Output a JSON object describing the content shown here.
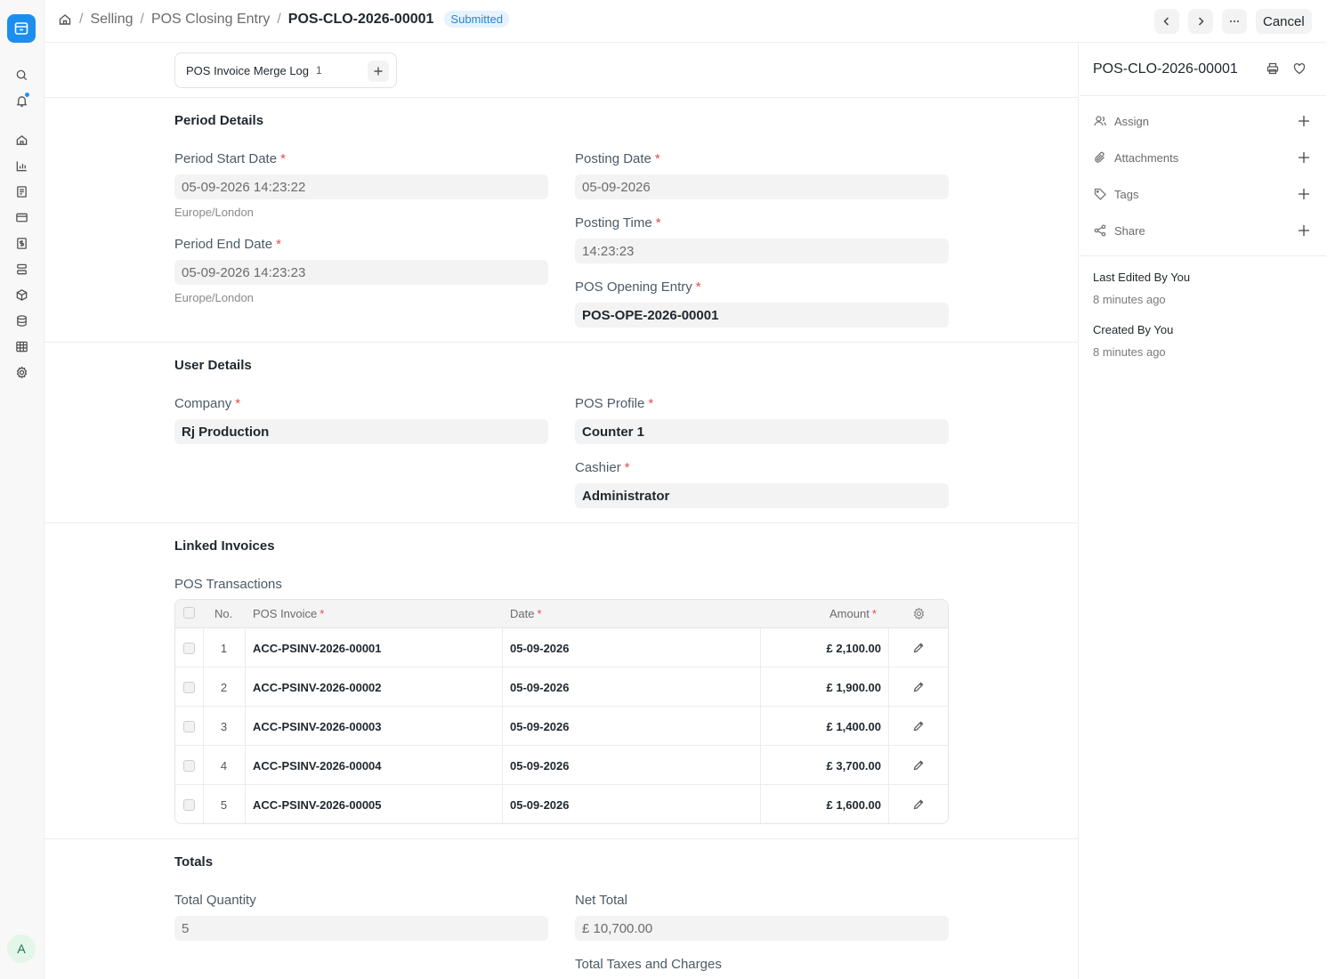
{
  "breadcrumb": {
    "module": "Selling",
    "doctype": "POS Closing Entry",
    "docname": "POS-CLO-2026-00001",
    "status": "Submitted"
  },
  "actions": {
    "cancel_label": "Cancel"
  },
  "avatar_initial": "A",
  "merge_log": {
    "label": "POS Invoice Merge Log",
    "count": "1"
  },
  "period": {
    "title": "Period Details",
    "start_label": "Period Start Date",
    "start_value": "05-09-2026 14:23:22",
    "start_tz": "Europe/London",
    "end_label": "Period End Date",
    "end_value": "05-09-2026 14:23:23",
    "end_tz": "Europe/London",
    "posting_date_label": "Posting Date",
    "posting_date_value": "05-09-2026",
    "posting_time_label": "Posting Time",
    "posting_time_value": "14:23:23",
    "opening_label": "POS Opening Entry",
    "opening_value": "POS-OPE-2026-00001"
  },
  "user": {
    "title": "User Details",
    "company_label": "Company",
    "company_value": "Rj Production",
    "profile_label": "POS Profile",
    "profile_value": "Counter 1",
    "cashier_label": "Cashier",
    "cashier_value": "Administrator"
  },
  "linked": {
    "title": "Linked Invoices",
    "table_label": "POS Transactions",
    "columns": {
      "no": "No.",
      "invoice": "POS Invoice",
      "date": "Date",
      "amount": "Amount"
    },
    "rows": [
      {
        "no": "1",
        "invoice": "ACC-PSINV-2026-00001",
        "date": "05-09-2026",
        "amount": "£ 2,100.00"
      },
      {
        "no": "2",
        "invoice": "ACC-PSINV-2026-00002",
        "date": "05-09-2026",
        "amount": "£ 1,900.00"
      },
      {
        "no": "3",
        "invoice": "ACC-PSINV-2026-00003",
        "date": "05-09-2026",
        "amount": "£ 1,400.00"
      },
      {
        "no": "4",
        "invoice": "ACC-PSINV-2026-00004",
        "date": "05-09-2026",
        "amount": "£ 3,700.00"
      },
      {
        "no": "5",
        "invoice": "ACC-PSINV-2026-00005",
        "date": "05-09-2026",
        "amount": "£ 1,600.00"
      }
    ]
  },
  "totals": {
    "title": "Totals",
    "qty_label": "Total Quantity",
    "qty_value": "5",
    "net_label": "Net Total",
    "net_value": "£ 10,700.00",
    "taxes_label": "Total Taxes and Charges"
  },
  "sidebar_right": {
    "title": "POS-CLO-2026-00001",
    "assign": "Assign",
    "attachments": "Attachments",
    "tags": "Tags",
    "share": "Share",
    "last_edited": "Last Edited By You",
    "last_edited_time": "8 minutes ago",
    "created": "Created By You",
    "created_time": "8 minutes ago"
  },
  "colors": {
    "accent": "#1c8ef0",
    "required": "#e24c4c",
    "badge_bg": "#e6f3fd"
  }
}
